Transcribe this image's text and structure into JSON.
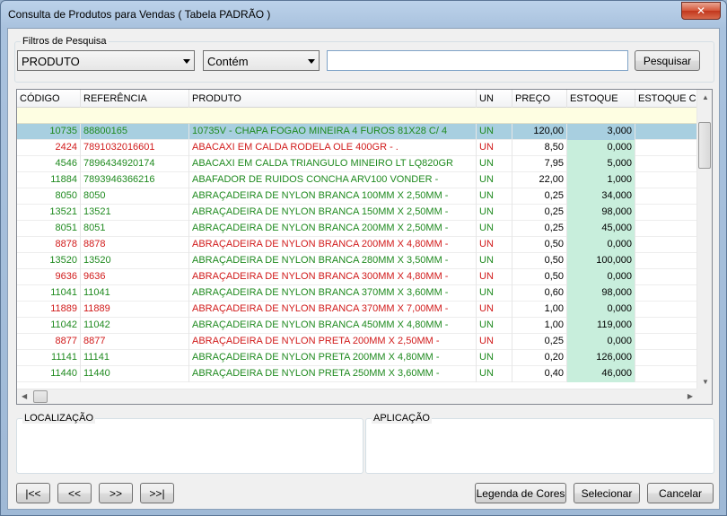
{
  "window": {
    "title": "Consulta de Produtos para Vendas ( Tabela PADRÃO )",
    "close_glyph": "✕"
  },
  "filters": {
    "caption": "Filtros de Pesquisa",
    "field_selected": "PRODUTO",
    "operator_selected": "Contém",
    "search_value": "",
    "search_button": "Pesquisar"
  },
  "grid": {
    "columns": [
      "CÓDIGO",
      "REFERÊNCIA",
      "PRODUTO",
      "UN",
      "PREÇO",
      "ESTOQUE",
      "ESTOQUE CO"
    ],
    "rows": [
      {
        "codigo": "10735",
        "referencia": "88800165",
        "produto": "10735V - CHAPA FOGAO MINEIRA 4 FUROS 81X28 C/ 4",
        "un": "UN",
        "preco": "120,00",
        "estoque": "3,000",
        "color": "green",
        "selected": true
      },
      {
        "codigo": "2424",
        "referencia": "7891032016601",
        "produto": "ABACAXI EM CALDA RODELA OLE 400GR - .",
        "un": "UN",
        "preco": "8,50",
        "estoque": "0,000",
        "color": "red",
        "selected": false
      },
      {
        "codigo": "4546",
        "referencia": "7896434920174",
        "produto": "ABACAXI EM CALDA TRIANGULO MINEIRO LT LQ820GR",
        "un": "UN",
        "preco": "7,95",
        "estoque": "5,000",
        "color": "green",
        "selected": false
      },
      {
        "codigo": "11884",
        "referencia": "7893946366216",
        "produto": "ABAFADOR DE RUIDOS CONCHA ARV100 VONDER -",
        "un": "UN",
        "preco": "22,00",
        "estoque": "1,000",
        "color": "green",
        "selected": false
      },
      {
        "codigo": "8050",
        "referencia": "8050",
        "produto": "ABRAÇADEIRA DE NYLON BRANCA 100MM X 2,50MM -",
        "un": "UN",
        "preco": "0,25",
        "estoque": "34,000",
        "color": "green",
        "selected": false
      },
      {
        "codigo": "13521",
        "referencia": "13521",
        "produto": "ABRAÇADEIRA DE NYLON BRANCA 150MM X 2,50MM -",
        "un": "UN",
        "preco": "0,25",
        "estoque": "98,000",
        "color": "green",
        "selected": false
      },
      {
        "codigo": "8051",
        "referencia": "8051",
        "produto": "ABRAÇADEIRA DE NYLON BRANCA 200MM X 2,50MM -",
        "un": "UN",
        "preco": "0,25",
        "estoque": "45,000",
        "color": "green",
        "selected": false
      },
      {
        "codigo": "8878",
        "referencia": "8878",
        "produto": "ABRAÇADEIRA DE NYLON BRANCA 200MM X 4,80MM -",
        "un": "UN",
        "preco": "0,50",
        "estoque": "0,000",
        "color": "red",
        "selected": false
      },
      {
        "codigo": "13520",
        "referencia": "13520",
        "produto": "ABRAÇADEIRA DE NYLON BRANCA 280MM X 3,50MM -",
        "un": "UN",
        "preco": "0,50",
        "estoque": "100,000",
        "color": "green",
        "selected": false
      },
      {
        "codigo": "9636",
        "referencia": "9636",
        "produto": "ABRAÇADEIRA DE NYLON BRANCA 300MM X 4,80MM -",
        "un": "UN",
        "preco": "0,50",
        "estoque": "0,000",
        "color": "red",
        "selected": false
      },
      {
        "codigo": "11041",
        "referencia": "11041",
        "produto": "ABRAÇADEIRA DE NYLON BRANCA 370MM X 3,60MM -",
        "un": "UN",
        "preco": "0,60",
        "estoque": "98,000",
        "color": "green",
        "selected": false
      },
      {
        "codigo": "11889",
        "referencia": "11889",
        "produto": "ABRAÇADEIRA DE NYLON BRANCA 370MM X 7,00MM -",
        "un": "UN",
        "preco": "1,00",
        "estoque": "0,000",
        "color": "red",
        "selected": false
      },
      {
        "codigo": "11042",
        "referencia": "11042",
        "produto": "ABRAÇADEIRA DE NYLON BRANCA 450MM X 4,80MM -",
        "un": "UN",
        "preco": "1,00",
        "estoque": "119,000",
        "color": "green",
        "selected": false
      },
      {
        "codigo": "8877",
        "referencia": "8877",
        "produto": "ABRAÇADEIRA DE NYLON PRETA 200MM X 2,50MM -",
        "un": "UN",
        "preco": "0,25",
        "estoque": "0,000",
        "color": "red",
        "selected": false
      },
      {
        "codigo": "11141",
        "referencia": "11141",
        "produto": "ABRAÇADEIRA DE NYLON PRETA 200MM X 4,80MM -",
        "un": "UN",
        "preco": "0,20",
        "estoque": "126,000",
        "color": "green",
        "selected": false
      },
      {
        "codigo": "11440",
        "referencia": "11440",
        "produto": "ABRAÇADEIRA DE NYLON PRETA 250MM X 3,60MM -",
        "un": "UN",
        "preco": "0,40",
        "estoque": "46,000",
        "color": "green",
        "selected": false
      }
    ]
  },
  "panels": {
    "localizacao_caption": "LOCALIZAÇÃO",
    "aplicacao_caption": "APLICAÇÃO"
  },
  "nav": {
    "first": "|<<",
    "prev": "<<",
    "next": ">>",
    "last": ">>|"
  },
  "actions": {
    "legend": "Legenda de Cores",
    "select": "Selecionar",
    "cancel": "Cancelar"
  },
  "colors": {
    "in_stock": "#1f8a1f",
    "out_of_stock": "#d11a1a",
    "selected_row": "#a8cfe0",
    "stock_column": "#c8eedc",
    "filter_row": "#fefee2"
  }
}
